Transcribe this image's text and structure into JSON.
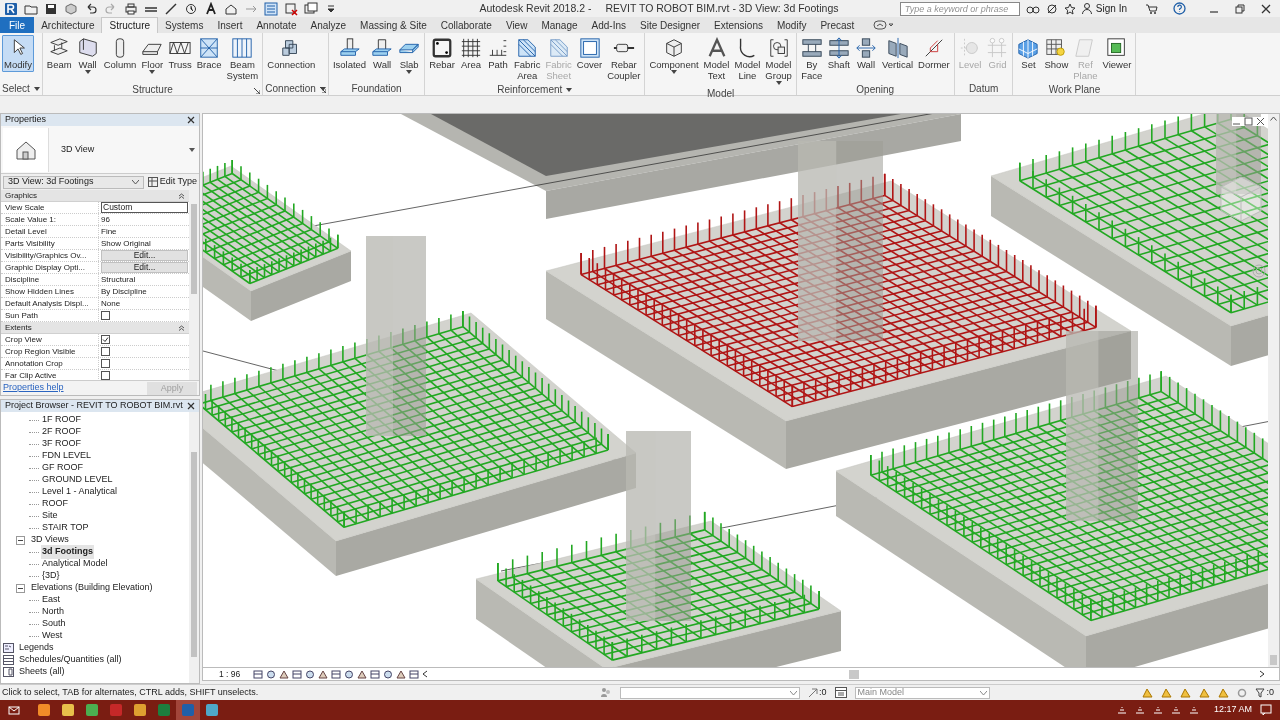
{
  "title_bar": {
    "app_title": "Autodesk Revit 2018.2 -",
    "document_title": "REVIT TO ROBOT BIM.rvt - 3D View: 3d Footings",
    "search": {
      "placeholder": "Type a keyword or phrase"
    },
    "sign_in": "Sign In"
  },
  "ribbon_tabs": [
    {
      "label": "File",
      "kind": "file",
      "selected": false
    },
    {
      "label": "Architecture",
      "kind": "tab",
      "selected": false
    },
    {
      "label": "Structure",
      "kind": "tab",
      "selected": true
    },
    {
      "label": "Systems",
      "kind": "tab",
      "selected": false
    },
    {
      "label": "Insert",
      "kind": "tab",
      "selected": false
    },
    {
      "label": "Annotate",
      "kind": "tab",
      "selected": false
    },
    {
      "label": "Analyze",
      "kind": "tab",
      "selected": false
    },
    {
      "label": "Massing & Site",
      "kind": "tab",
      "selected": false
    },
    {
      "label": "Collaborate",
      "kind": "tab",
      "selected": false
    },
    {
      "label": "View",
      "kind": "tab",
      "selected": false
    },
    {
      "label": "Manage",
      "kind": "tab",
      "selected": false
    },
    {
      "label": "Add-Ins",
      "kind": "tab",
      "selected": false
    },
    {
      "label": "Site Designer",
      "kind": "tab",
      "selected": false
    },
    {
      "label": "Extensions",
      "kind": "tab",
      "selected": false
    },
    {
      "label": "Modify",
      "kind": "tab",
      "selected": false
    },
    {
      "label": "Precast",
      "kind": "tab",
      "selected": false
    }
  ],
  "ribbon_panels": [
    {
      "title": "Select",
      "menu": true,
      "launcher": false,
      "tools": [
        {
          "label": "Modify",
          "selected": true,
          "disabled": false,
          "dropdown": false
        }
      ]
    },
    {
      "title": "Structure",
      "menu": false,
      "launcher": true,
      "tools": [
        {
          "label": "Beam",
          "selected": false,
          "disabled": false,
          "dropdown": false
        },
        {
          "label": "Wall",
          "selected": false,
          "disabled": false,
          "dropdown": true
        },
        {
          "label": "Column",
          "selected": false,
          "disabled": false,
          "dropdown": false
        },
        {
          "label": "Floor",
          "selected": false,
          "disabled": false,
          "dropdown": true
        },
        {
          "label": "Truss",
          "selected": false,
          "disabled": false,
          "dropdown": false
        },
        {
          "label": "Brace",
          "selected": false,
          "disabled": false,
          "dropdown": false
        },
        {
          "label": "Beam System",
          "selected": false,
          "disabled": false,
          "dropdown": false
        }
      ]
    },
    {
      "title": "Connection",
      "menu": true,
      "launcher": true,
      "tools": [
        {
          "label": "Connection",
          "selected": false,
          "disabled": false,
          "dropdown": false
        }
      ]
    },
    {
      "title": "Foundation",
      "menu": false,
      "launcher": false,
      "tools": [
        {
          "label": "Isolated",
          "selected": false,
          "disabled": false,
          "dropdown": false
        },
        {
          "label": "Wall",
          "selected": false,
          "disabled": false,
          "dropdown": false
        },
        {
          "label": "Slab",
          "selected": false,
          "disabled": false,
          "dropdown": true
        }
      ]
    },
    {
      "title": "Reinforcement",
      "menu": true,
      "launcher": false,
      "tools": [
        {
          "label": "Rebar",
          "selected": false,
          "disabled": false,
          "dropdown": false
        },
        {
          "label": "Area",
          "selected": false,
          "disabled": false,
          "dropdown": false
        },
        {
          "label": "Path",
          "selected": false,
          "disabled": false,
          "dropdown": false
        },
        {
          "label": "Fabric Area",
          "selected": false,
          "disabled": false,
          "dropdown": false
        },
        {
          "label": "Fabric Sheet",
          "selected": false,
          "disabled": true,
          "dropdown": false
        },
        {
          "label": "Cover",
          "selected": false,
          "disabled": false,
          "dropdown": false
        },
        {
          "label": "Rebar Coupler",
          "selected": false,
          "disabled": false,
          "dropdown": false
        }
      ]
    },
    {
      "title": "Model",
      "menu": false,
      "launcher": false,
      "tools": [
        {
          "label": "Component",
          "selected": false,
          "disabled": false,
          "dropdown": true
        },
        {
          "label": "Model Text",
          "selected": false,
          "disabled": false,
          "dropdown": false
        },
        {
          "label": "Model Line",
          "selected": false,
          "disabled": false,
          "dropdown": false
        },
        {
          "label": "Model Group",
          "selected": false,
          "disabled": false,
          "dropdown": true
        }
      ]
    },
    {
      "title": "Opening",
      "menu": false,
      "launcher": false,
      "tools": [
        {
          "label": "By Face",
          "selected": false,
          "disabled": false,
          "dropdown": false
        },
        {
          "label": "Shaft",
          "selected": false,
          "disabled": false,
          "dropdown": false
        },
        {
          "label": "Wall",
          "selected": false,
          "disabled": false,
          "dropdown": false
        },
        {
          "label": "Vertical",
          "selected": false,
          "disabled": false,
          "dropdown": false
        },
        {
          "label": "Dormer",
          "selected": false,
          "disabled": false,
          "dropdown": false
        }
      ]
    },
    {
      "title": "Datum",
      "menu": false,
      "launcher": false,
      "tools": [
        {
          "label": "Level",
          "selected": false,
          "disabled": true,
          "dropdown": false
        },
        {
          "label": "Grid",
          "selected": false,
          "disabled": true,
          "dropdown": false
        }
      ]
    },
    {
      "title": "Work Plane",
      "menu": false,
      "launcher": false,
      "tools": [
        {
          "label": "Set",
          "selected": false,
          "disabled": false,
          "dropdown": false
        },
        {
          "label": "Show",
          "selected": false,
          "disabled": false,
          "dropdown": false
        },
        {
          "label": "Ref Plane",
          "selected": false,
          "disabled": true,
          "dropdown": false
        },
        {
          "label": "Viewer",
          "selected": false,
          "disabled": false,
          "dropdown": false
        }
      ]
    }
  ],
  "properties": {
    "title": "Properties",
    "type_name": "3D View",
    "view_selector": "3D View: 3d Footings",
    "edit_type": "Edit Type",
    "groups": [
      {
        "name": "Graphics",
        "rows": [
          {
            "label": "View Scale",
            "kind": "input",
            "value": "Custom"
          },
          {
            "label": "Scale Value    1:",
            "kind": "text",
            "value": "96"
          },
          {
            "label": "Detail Level",
            "kind": "text",
            "value": "Fine"
          },
          {
            "label": "Parts Visibility",
            "kind": "text",
            "value": "Show Original"
          },
          {
            "label": "Visibility/Graphics Ov...",
            "kind": "button",
            "value": "Edit..."
          },
          {
            "label": "Graphic Display Opti...",
            "kind": "button",
            "value": "Edit..."
          },
          {
            "label": "Discipline",
            "kind": "text",
            "value": "Structural"
          },
          {
            "label": "Show Hidden Lines",
            "kind": "text",
            "value": "By Discipline"
          },
          {
            "label": "Default Analysis Displ...",
            "kind": "text",
            "value": "None"
          },
          {
            "label": "Sun Path",
            "kind": "checkbox",
            "checked": false
          }
        ]
      },
      {
        "name": "Extents",
        "rows": [
          {
            "label": "Crop View",
            "kind": "checkbox",
            "checked": true
          },
          {
            "label": "Crop Region Visible",
            "kind": "checkbox",
            "checked": false
          },
          {
            "label": "Annotation Crop",
            "kind": "checkbox",
            "checked": false
          },
          {
            "label": "Far Clip Active",
            "kind": "checkbox",
            "checked": false
          }
        ]
      }
    ],
    "help_link": "Properties help",
    "apply": {
      "label": "Apply",
      "disabled": true
    }
  },
  "project_browser": {
    "title": "Project Browser - REVIT TO ROBOT BIM.rvt",
    "tree": [
      {
        "children": [
          {
            "children": [
              {
                "label": "1F ROOF",
                "selected": false
              },
              {
                "label": "2F ROOF",
                "selected": false
              },
              {
                "label": "3F ROOF",
                "selected": false
              },
              {
                "label": "FDN LEVEL",
                "selected": false
              },
              {
                "label": "GF ROOF",
                "selected": false
              },
              {
                "label": "GROUND LEVEL",
                "selected": false
              },
              {
                "label": "Level 1 - Analytical",
                "selected": false
              },
              {
                "label": "ROOF",
                "selected": false
              },
              {
                "label": "Site",
                "selected": false
              },
              {
                "label": "STAIR TOP",
                "selected": false
              }
            ]
          },
          {
            "label": "3D Views",
            "expanded": true,
            "selected": false,
            "children": [
              {
                "label": "3d Footings",
                "selected": true
              },
              {
                "label": "Analytical Model",
                "selected": false
              },
              {
                "label": "{3D}",
                "selected": false
              }
            ]
          },
          {
            "label": "Elevations (Building Elevation)",
            "expanded": true,
            "selected": false,
            "children": [
              {
                "label": "East",
                "selected": false
              },
              {
                "label": "North",
                "selected": false
              },
              {
                "label": "South",
                "selected": false
              },
              {
                "label": "West",
                "selected": false
              }
            ]
          }
        ]
      },
      {
        "label": "Legends",
        "kind": "legend",
        "selected": false
      },
      {
        "label": "Schedules/Quantities (all)",
        "kind": "schedule",
        "selected": false
      },
      {
        "label": "Sheets (all)",
        "kind": "sheet",
        "selected": false
      }
    ]
  },
  "view_control_bar": {
    "scale": "1 : 96"
  },
  "status_bar": {
    "message": "Click to select, TAB for alternates, CTRL adds, SHIFT unselects.",
    "workset_count": ":0",
    "design_option": "Main Model",
    "filter_count": ":0"
  },
  "taskbar": {
    "time": "12:17 AM"
  }
}
